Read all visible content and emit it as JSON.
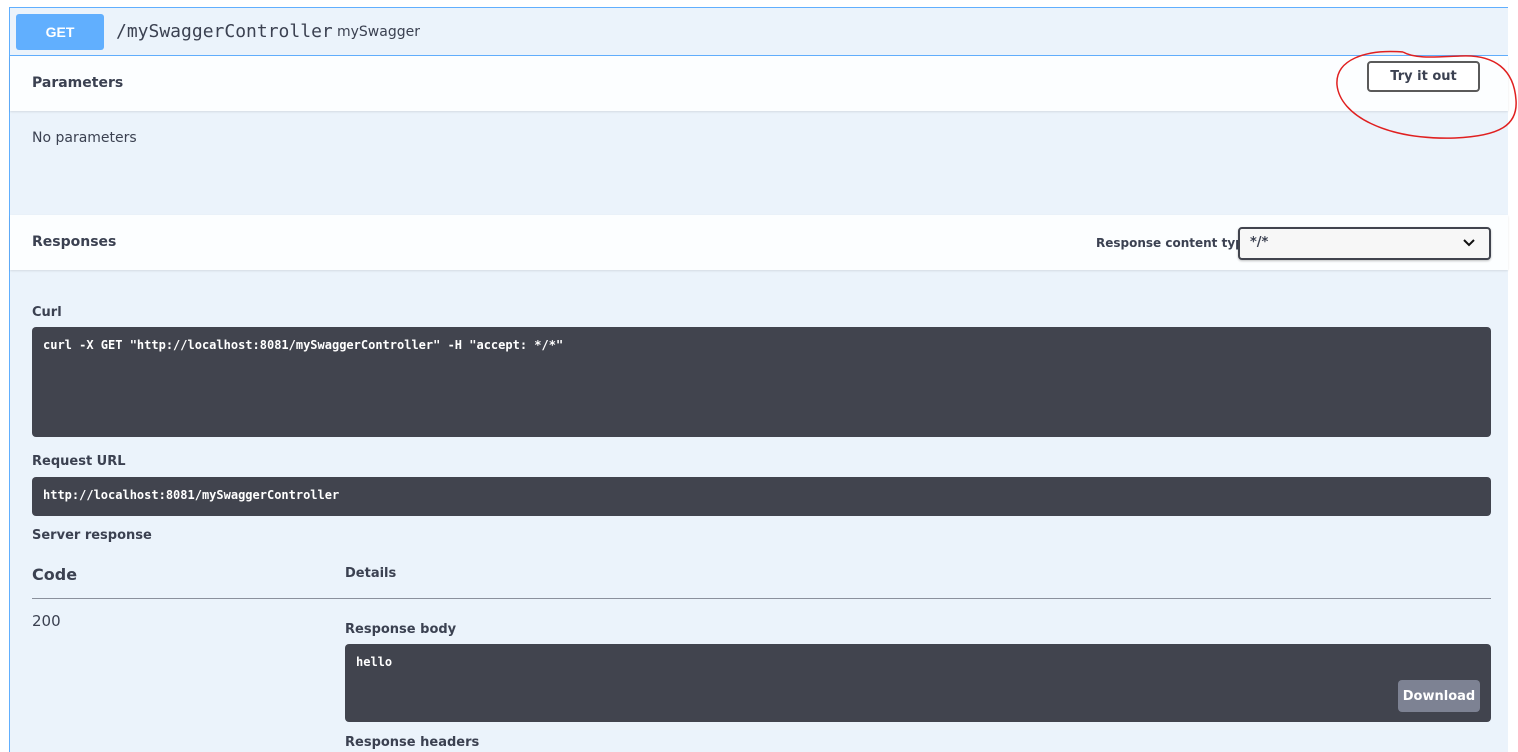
{
  "operation": {
    "method": "GET",
    "path": "/mySwaggerController",
    "description": "mySwagger"
  },
  "parameters": {
    "title": "Parameters",
    "try_button": "Try it out",
    "empty_text": "No parameters"
  },
  "responses": {
    "title": "Responses",
    "content_type_label": "Response content type",
    "content_type_value": "*/*"
  },
  "curl": {
    "label": "Curl",
    "command": "curl -X GET \"http://localhost:8081/mySwaggerController\" -H \"accept: */*\""
  },
  "request_url": {
    "label": "Request URL",
    "value": "http://localhost:8081/mySwaggerController"
  },
  "server_response": {
    "label": "Server response",
    "col_code": "Code",
    "col_details": "Details",
    "code": "200",
    "body_label": "Response body",
    "body": "hello",
    "download_button": "Download",
    "headers_label": "Response headers"
  },
  "colors": {
    "get_method": "#61affe",
    "panel_bg": "#ebf3fb",
    "code_bg": "#41444e",
    "annotation": "#e02020"
  },
  "icons": {
    "select_chevron": "chevron-down-icon"
  }
}
